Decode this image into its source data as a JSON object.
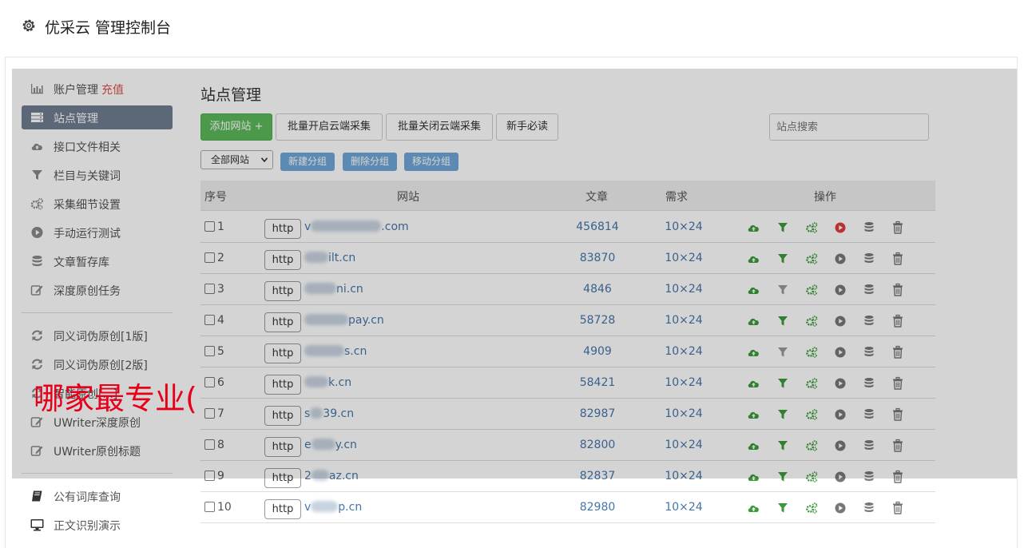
{
  "app": {
    "title": "优采云 管理控制台"
  },
  "sidebar": {
    "items": [
      {
        "label": "账户管理",
        "extra": "充值",
        "icon": "bar-chart-icon"
      },
      {
        "label": "站点管理",
        "icon": "server-icon",
        "active": true
      },
      {
        "label": "接口文件相关",
        "icon": "cloud-upload-icon"
      },
      {
        "label": "栏目与关键词",
        "icon": "filter-icon"
      },
      {
        "label": "采集细节设置",
        "icon": "cogs-icon"
      },
      {
        "label": "手动运行测试",
        "icon": "play-circle-icon"
      },
      {
        "label": "文章暂存库",
        "icon": "database-icon"
      },
      {
        "label": "深度原创任务",
        "icon": "edit-icon"
      },
      {
        "label": "同义词伪原创[1版]",
        "icon": "refresh-icon"
      },
      {
        "label": "同义词伪原创[2版]",
        "icon": "refresh-icon"
      },
      {
        "label": "智能原创[...]",
        "icon": "refresh-icon"
      },
      {
        "label": "UWriter深度原创",
        "icon": "edit-icon"
      },
      {
        "label": "UWriter原创标题",
        "icon": "edit-icon"
      },
      {
        "label": "公有词库查询",
        "icon": "book-icon"
      },
      {
        "label": "正文识别演示",
        "icon": "monitor-icon"
      }
    ]
  },
  "main": {
    "title": "站点管理",
    "toolbar": {
      "add_label": "添加网站 +",
      "batch_on_label": "批量开启云端采集",
      "batch_off_label": "批量关闭云端采集",
      "guide_label": "新手必读",
      "search_placeholder": "站点搜索"
    },
    "group": {
      "select_value": "全部网站",
      "new_label": "新建分组",
      "delete_label": "删除分组",
      "move_label": "移动分组"
    },
    "table": {
      "headers": {
        "index": "序号",
        "site": "网站",
        "articles": "文章",
        "demand": "需求",
        "ops": "操作"
      },
      "rows": [
        {
          "index": "1",
          "protocol": "http",
          "site_prefix": "v",
          "site_suffix": ".com",
          "articles": "456814",
          "demand": "10×24",
          "run_active": true,
          "filter_active": true
        },
        {
          "index": "2",
          "protocol": "http",
          "site_prefix": "",
          "site_suffix": "ilt.cn",
          "articles": "83870",
          "demand": "10×24",
          "run_active": false,
          "filter_active": true
        },
        {
          "index": "3",
          "protocol": "http",
          "site_prefix": "",
          "site_suffix": "ni.cn",
          "articles": "4846",
          "demand": "10×24",
          "run_active": false,
          "filter_active": false
        },
        {
          "index": "4",
          "protocol": "http",
          "site_prefix": "",
          "site_suffix": "pay.cn",
          "articles": "58728",
          "demand": "10×24",
          "run_active": false,
          "filter_active": true
        },
        {
          "index": "5",
          "protocol": "http",
          "site_prefix": "",
          "site_suffix": "s.cn",
          "articles": "4909",
          "demand": "10×24",
          "run_active": false,
          "filter_active": false
        },
        {
          "index": "6",
          "protocol": "http",
          "site_prefix": "",
          "site_suffix": "k.cn",
          "articles": "58421",
          "demand": "10×24",
          "run_active": false,
          "filter_active": true
        },
        {
          "index": "7",
          "protocol": "http",
          "site_prefix": "s",
          "site_suffix": "39.cn",
          "articles": "82987",
          "demand": "10×24",
          "run_active": false,
          "filter_active": true
        },
        {
          "index": "8",
          "protocol": "http",
          "site_prefix": "e",
          "site_suffix": "y.cn",
          "articles": "82800",
          "demand": "10×24",
          "run_active": false,
          "filter_active": true
        },
        {
          "index": "9",
          "protocol": "http",
          "site_prefix": "2",
          "site_suffix": "az.cn",
          "articles": "82837",
          "demand": "10×24",
          "run_active": false,
          "filter_active": true
        },
        {
          "index": "10",
          "protocol": "http",
          "site_prefix": "v",
          "site_suffix": "p.cn",
          "articles": "82980",
          "demand": "10×24",
          "run_active": false,
          "filter_active": true
        }
      ]
    }
  },
  "watermark": "哪家最专业(",
  "colors": {
    "accent_green": "#5cb85c",
    "sidebar_active": "#6f7d91",
    "link_blue": "#4575a9",
    "run_red": "#e03c3c",
    "recharge_red": "#d9534f"
  }
}
